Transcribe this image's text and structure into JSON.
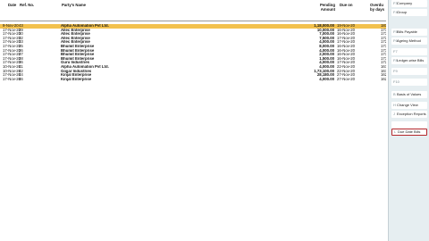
{
  "header": {
    "date": "Date",
    "ref_no": "Ref. No.",
    "party": "Party's Name",
    "pending_line1": "Pending",
    "pending_line2": "Amount",
    "due_on": "Due on",
    "overdue_line1": "Overdu",
    "overdue_line2": "by days"
  },
  "rows": [
    {
      "date": "9-Nov-20",
      "ref": "43",
      "party": "Alpha Automation Pvt Ltd.",
      "amount": "1,18,000.00",
      "due": "19-Nov-20",
      "od": "181",
      "selected": true
    },
    {
      "date": "17-Nov-20",
      "ref": "29",
      "party": "Allec Enterprise",
      "amount": "10,000.00",
      "due": "16-Nov-20",
      "od": "173"
    },
    {
      "date": "17-Nov-20",
      "ref": "30",
      "party": "Allec Enterprise",
      "amount": "7,000.00",
      "due": "16-Nov-20",
      "od": "173"
    },
    {
      "date": "17-Nov-20",
      "ref": "32",
      "party": "Allec Enterprise",
      "amount": "7,500.00",
      "due": "17-Nov-20",
      "od": "172"
    },
    {
      "date": "17-Nov-20",
      "ref": "33",
      "party": "Allec Enterprise",
      "amount": "4,000.00",
      "due": "17-Nov-20",
      "od": "172"
    },
    {
      "date": "17-Nov-20",
      "ref": "25",
      "party": "Bhumit Enterprise",
      "amount": "8,000.00",
      "due": "16-Nov-20",
      "od": "173"
    },
    {
      "date": "17-Nov-20",
      "ref": "26",
      "party": "Bhumit Enterprise",
      "amount": "4,000.00",
      "due": "16-Nov-20",
      "od": "173"
    },
    {
      "date": "17-Nov-20",
      "ref": "27",
      "party": "Bhumit Enterprise",
      "amount": "2,000.00",
      "due": "16-Nov-20",
      "od": "173"
    },
    {
      "date": "17-Nov-20",
      "ref": "28",
      "party": "Bhumit Enterprise",
      "amount": "1,500.00",
      "due": "16-Nov-20",
      "od": "173"
    },
    {
      "date": "17-Nov-20",
      "ref": "36",
      "party": "Guru Industries",
      "amount": "4,000.00",
      "due": "17-Nov-20",
      "od": "172"
    },
    {
      "date": "10-Nov-20",
      "ref": "41",
      "party": "Alpha Automation Pvt Ltd.",
      "amount": "4,000.00",
      "due": "22-Nov-20",
      "od": "167"
    },
    {
      "date": "10-Nov-20",
      "ref": "42",
      "party": "Gojjar Industries",
      "amount": "1,73,100.00",
      "due": "22-Nov-20",
      "od": "167"
    },
    {
      "date": "17-Nov-20",
      "ref": "44",
      "party": "Kinjal Enterprise",
      "amount": "28,180.00",
      "due": "27-Nov-20",
      "od": "162"
    },
    {
      "date": "17-Nov-20",
      "ref": "46",
      "party": "Kinjal Enterprise",
      "amount": "4,000.00",
      "due": "27-Nov-20",
      "od": "162"
    }
  ],
  "sidebar": [
    {
      "key": "F3",
      "label": "Company"
    },
    {
      "key": "F4",
      "label": "Group"
    },
    {
      "key": "F5",
      "label": "Bills Payable"
    },
    {
      "key": "F6",
      "label": "Ageing Method"
    },
    {
      "key": "F7",
      "label": ""
    },
    {
      "key": "F8",
      "label": "Ledger-wise Bills"
    },
    {
      "key": "F9",
      "label": ""
    },
    {
      "key": "F10",
      "label": ""
    },
    {
      "key": "B",
      "label": "Basis of Values"
    },
    {
      "key": "H",
      "label": "Change View"
    },
    {
      "key": "J",
      "label": "Exception Reports"
    },
    {
      "key": "",
      "label": ""
    },
    {
      "key": "L",
      "label": "Due Date Bills"
    }
  ]
}
